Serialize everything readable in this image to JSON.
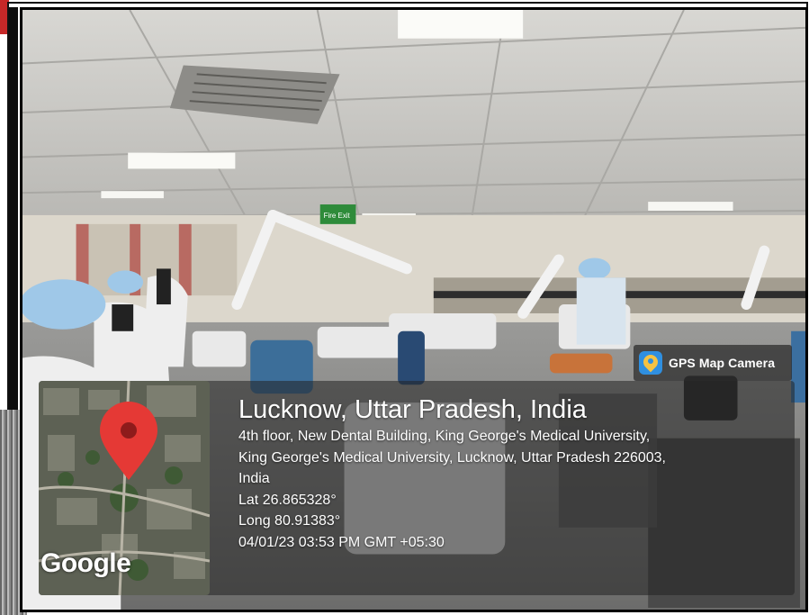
{
  "badge": {
    "label": "GPS Map Camera",
    "icon": "gps-map-camera-icon"
  },
  "map": {
    "brand": "Google",
    "pin_icon": "location-pin-icon"
  },
  "location": {
    "title": "Lucknow, Uttar Pradesh, India",
    "address_1": "4th floor, New Dental Building, King George's Medical University,",
    "address_2": "King George's Medical University, Lucknow, Uttar Pradesh 226003,",
    "address_3": "India",
    "lat": "Lat 26.865328°",
    "long": "Long 80.91383°",
    "datetime": "04/01/23 03:53 PM GMT +05:30"
  },
  "photo": {
    "signs": {
      "exit": "Fire Exit"
    }
  },
  "colors": {
    "pin": "#e53935",
    "badge_icon": "#2f8fe0",
    "overlay": "#232323"
  }
}
